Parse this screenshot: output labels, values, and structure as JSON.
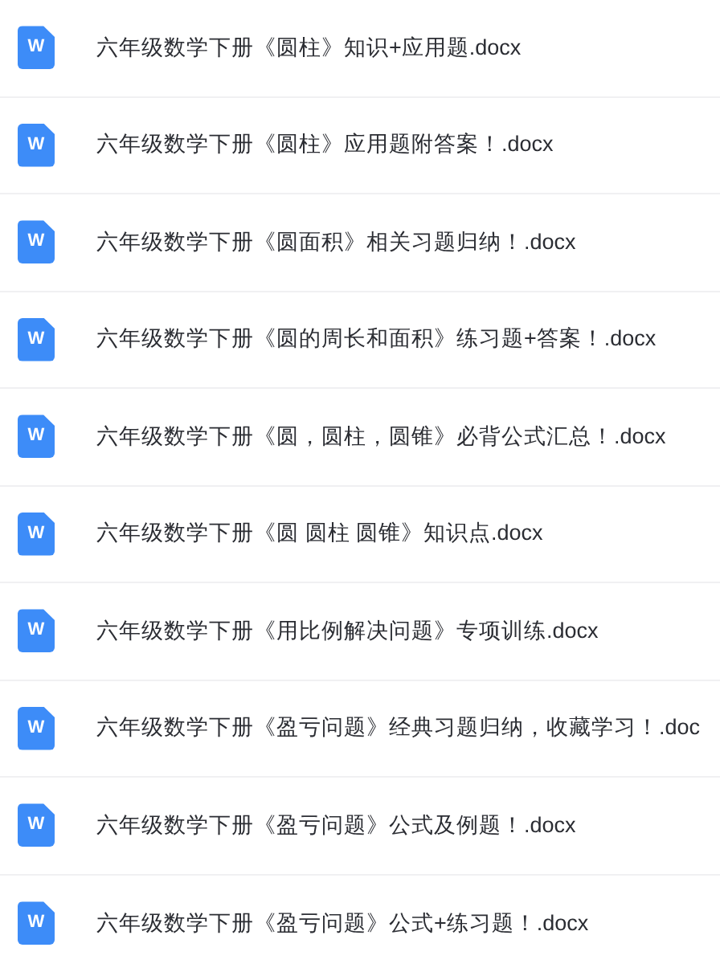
{
  "files": [
    {
      "name": "六年级数学下册《圆柱》知识+应用题.docx",
      "icon_letter": "W"
    },
    {
      "name": "六年级数学下册《圆柱》应用题附答案！.docx",
      "icon_letter": "W"
    },
    {
      "name": "六年级数学下册《圆面积》相关习题归纳！.docx",
      "icon_letter": "W"
    },
    {
      "name": "六年级数学下册《圆的周长和面积》练习题+答案！.docx",
      "icon_letter": "W"
    },
    {
      "name": "六年级数学下册《圆，圆柱，圆锥》必背公式汇总！.docx",
      "icon_letter": "W"
    },
    {
      "name": "六年级数学下册《圆 圆柱 圆锥》知识点.docx",
      "icon_letter": "W"
    },
    {
      "name": "六年级数学下册《用比例解决问题》专项训练.docx",
      "icon_letter": "W"
    },
    {
      "name": "六年级数学下册《盈亏问题》经典习题归纳，收藏学习！.doc",
      "icon_letter": "W"
    },
    {
      "name": "六年级数学下册《盈亏问题》公式及例题！.docx",
      "icon_letter": "W"
    },
    {
      "name": "六年级数学下册《盈亏问题》公式+练习题！.docx",
      "icon_letter": "W"
    }
  ]
}
